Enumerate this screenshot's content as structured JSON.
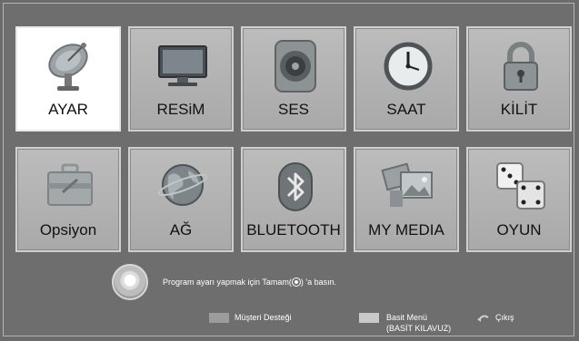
{
  "menu": {
    "tiles": [
      {
        "label": "AYAR",
        "icon": "satellite-dish-icon",
        "selected": true
      },
      {
        "label": "RESiM",
        "icon": "tv-icon",
        "selected": false
      },
      {
        "label": "SES",
        "icon": "speaker-icon",
        "selected": false
      },
      {
        "label": "SAAT",
        "icon": "clock-icon",
        "selected": false
      },
      {
        "label": "KİLİT",
        "icon": "padlock-icon",
        "selected": false
      },
      {
        "label": "Opsiyon",
        "icon": "toolbox-icon",
        "selected": false
      },
      {
        "label": "AĞ",
        "icon": "globe-icon",
        "selected": false
      },
      {
        "label": "BLUETOOTH",
        "icon": "bluetooth-icon",
        "selected": false
      },
      {
        "label": "MY MEDIA",
        "icon": "media-photos-icon",
        "selected": false
      },
      {
        "label": "OYUN",
        "icon": "dice-icon",
        "selected": false
      }
    ]
  },
  "hint": {
    "text_before": "Program ayarı yapmak için Tamam(",
    "text_after": ") 'a basın."
  },
  "footer": {
    "support_label": "Müşteri Desteği",
    "simple_menu_label": "Basit Menü",
    "simple_menu_sub": "(BASİT KILAVUZ)",
    "exit_label": "Çıkış",
    "colors": {
      "support": "#9c9c9c",
      "simple_menu": "#c9c9c9"
    }
  }
}
